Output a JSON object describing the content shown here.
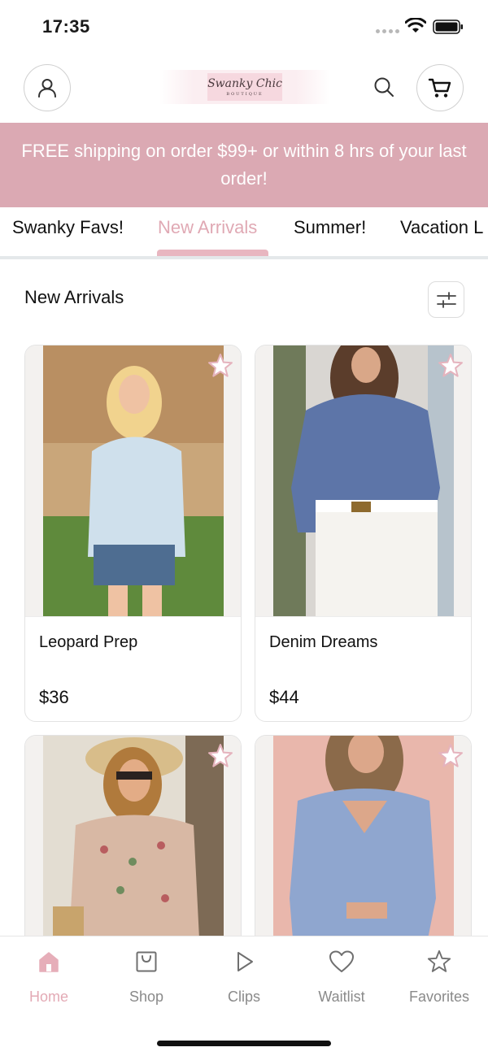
{
  "status_bar": {
    "time": "17:35"
  },
  "header": {
    "logo_text": "Swanky Chic",
    "logo_subtext": "BOUTIQUE"
  },
  "promo": {
    "text": "FREE shipping on order $99+ or within 8 hrs of your last order!"
  },
  "category_tabs": [
    {
      "label": "Swanky Favs!"
    },
    {
      "label": "New Arrivals",
      "active": true
    },
    {
      "label": "Summer!"
    },
    {
      "label": "Vacation L"
    }
  ],
  "section": {
    "title": "New Arrivals"
  },
  "products": [
    {
      "name": "Leopard Prep",
      "price": "$36"
    },
    {
      "name": "Denim Dreams",
      "price": "$44"
    },
    {
      "name": "",
      "price": ""
    },
    {
      "name": "",
      "price": ""
    }
  ],
  "tabbar": [
    {
      "label": "Home",
      "icon": "home-icon",
      "active": true
    },
    {
      "label": "Shop",
      "icon": "shopping-bag-icon"
    },
    {
      "label": "Clips",
      "icon": "play-icon"
    },
    {
      "label": "Waitlist",
      "icon": "heart-icon"
    },
    {
      "label": "Favorites",
      "icon": "star-icon"
    }
  ],
  "colors": {
    "accent_pink": "#dba9b3",
    "active_pink": "#e3aab5",
    "text": "#111111",
    "muted": "#8a8a8a"
  }
}
